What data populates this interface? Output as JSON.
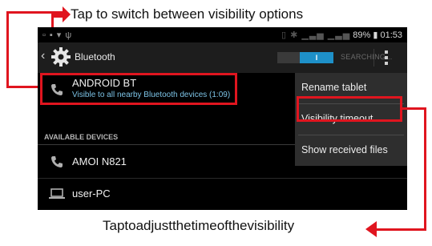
{
  "captions": {
    "top": "Tap to switch between visibility options",
    "bottom": "Taptoadjustthetimeofthevisibility"
  },
  "status_bar": {
    "battery": "89%",
    "time": "01:53"
  },
  "action_bar": {
    "title": "Bluetooth",
    "toggle_label": "I",
    "status": "SEARCHING..."
  },
  "paired": {
    "name": "ANDROID BT",
    "subtitle": "Visible to all nearby Bluetooth devices (1:09)"
  },
  "available": {
    "header": "AVAILABLE DEVICES",
    "devices": [
      {
        "name": "AMOI N821",
        "icon": "phone-icon"
      },
      {
        "name": "user-PC",
        "icon": "laptop-icon"
      }
    ]
  },
  "menu": {
    "items": [
      "Rename tablet",
      "Visibility timeout",
      "Show received files"
    ]
  },
  "colors": {
    "highlight": "#e0151f",
    "accent": "#1e90c8",
    "subtitle": "#7cc3e6"
  }
}
